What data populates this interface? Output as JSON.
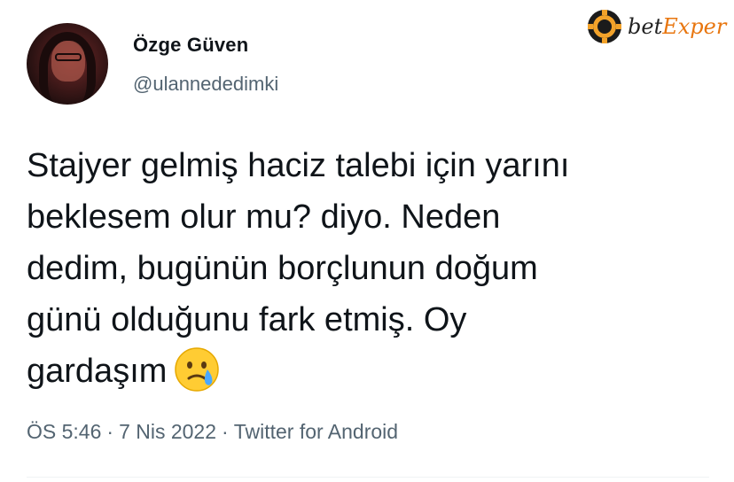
{
  "author": {
    "name": "Özge Güven",
    "handle": "@ulannededimki",
    "avatar_icon": "profile-photo"
  },
  "watermark": {
    "brand_prefix": "bet",
    "brand_suffix": "Exper",
    "accent_color": "#e8760f",
    "icon": "casino-chip-icon"
  },
  "tweet": {
    "lines": [
      "Stajyer gelmiş haciz talebi için yarını",
      "beklesem olur mu? diyo. Neden",
      "dedim, bugünün borçlunun doğum",
      "günü olduğunu fark etmiş. Oy",
      "gardaşım"
    ],
    "emoji": "crying-face-emoji"
  },
  "meta": {
    "time": "ÖS 5:46",
    "date": "7 Nis 2022",
    "source": "Twitter for Android",
    "separator": "·"
  }
}
